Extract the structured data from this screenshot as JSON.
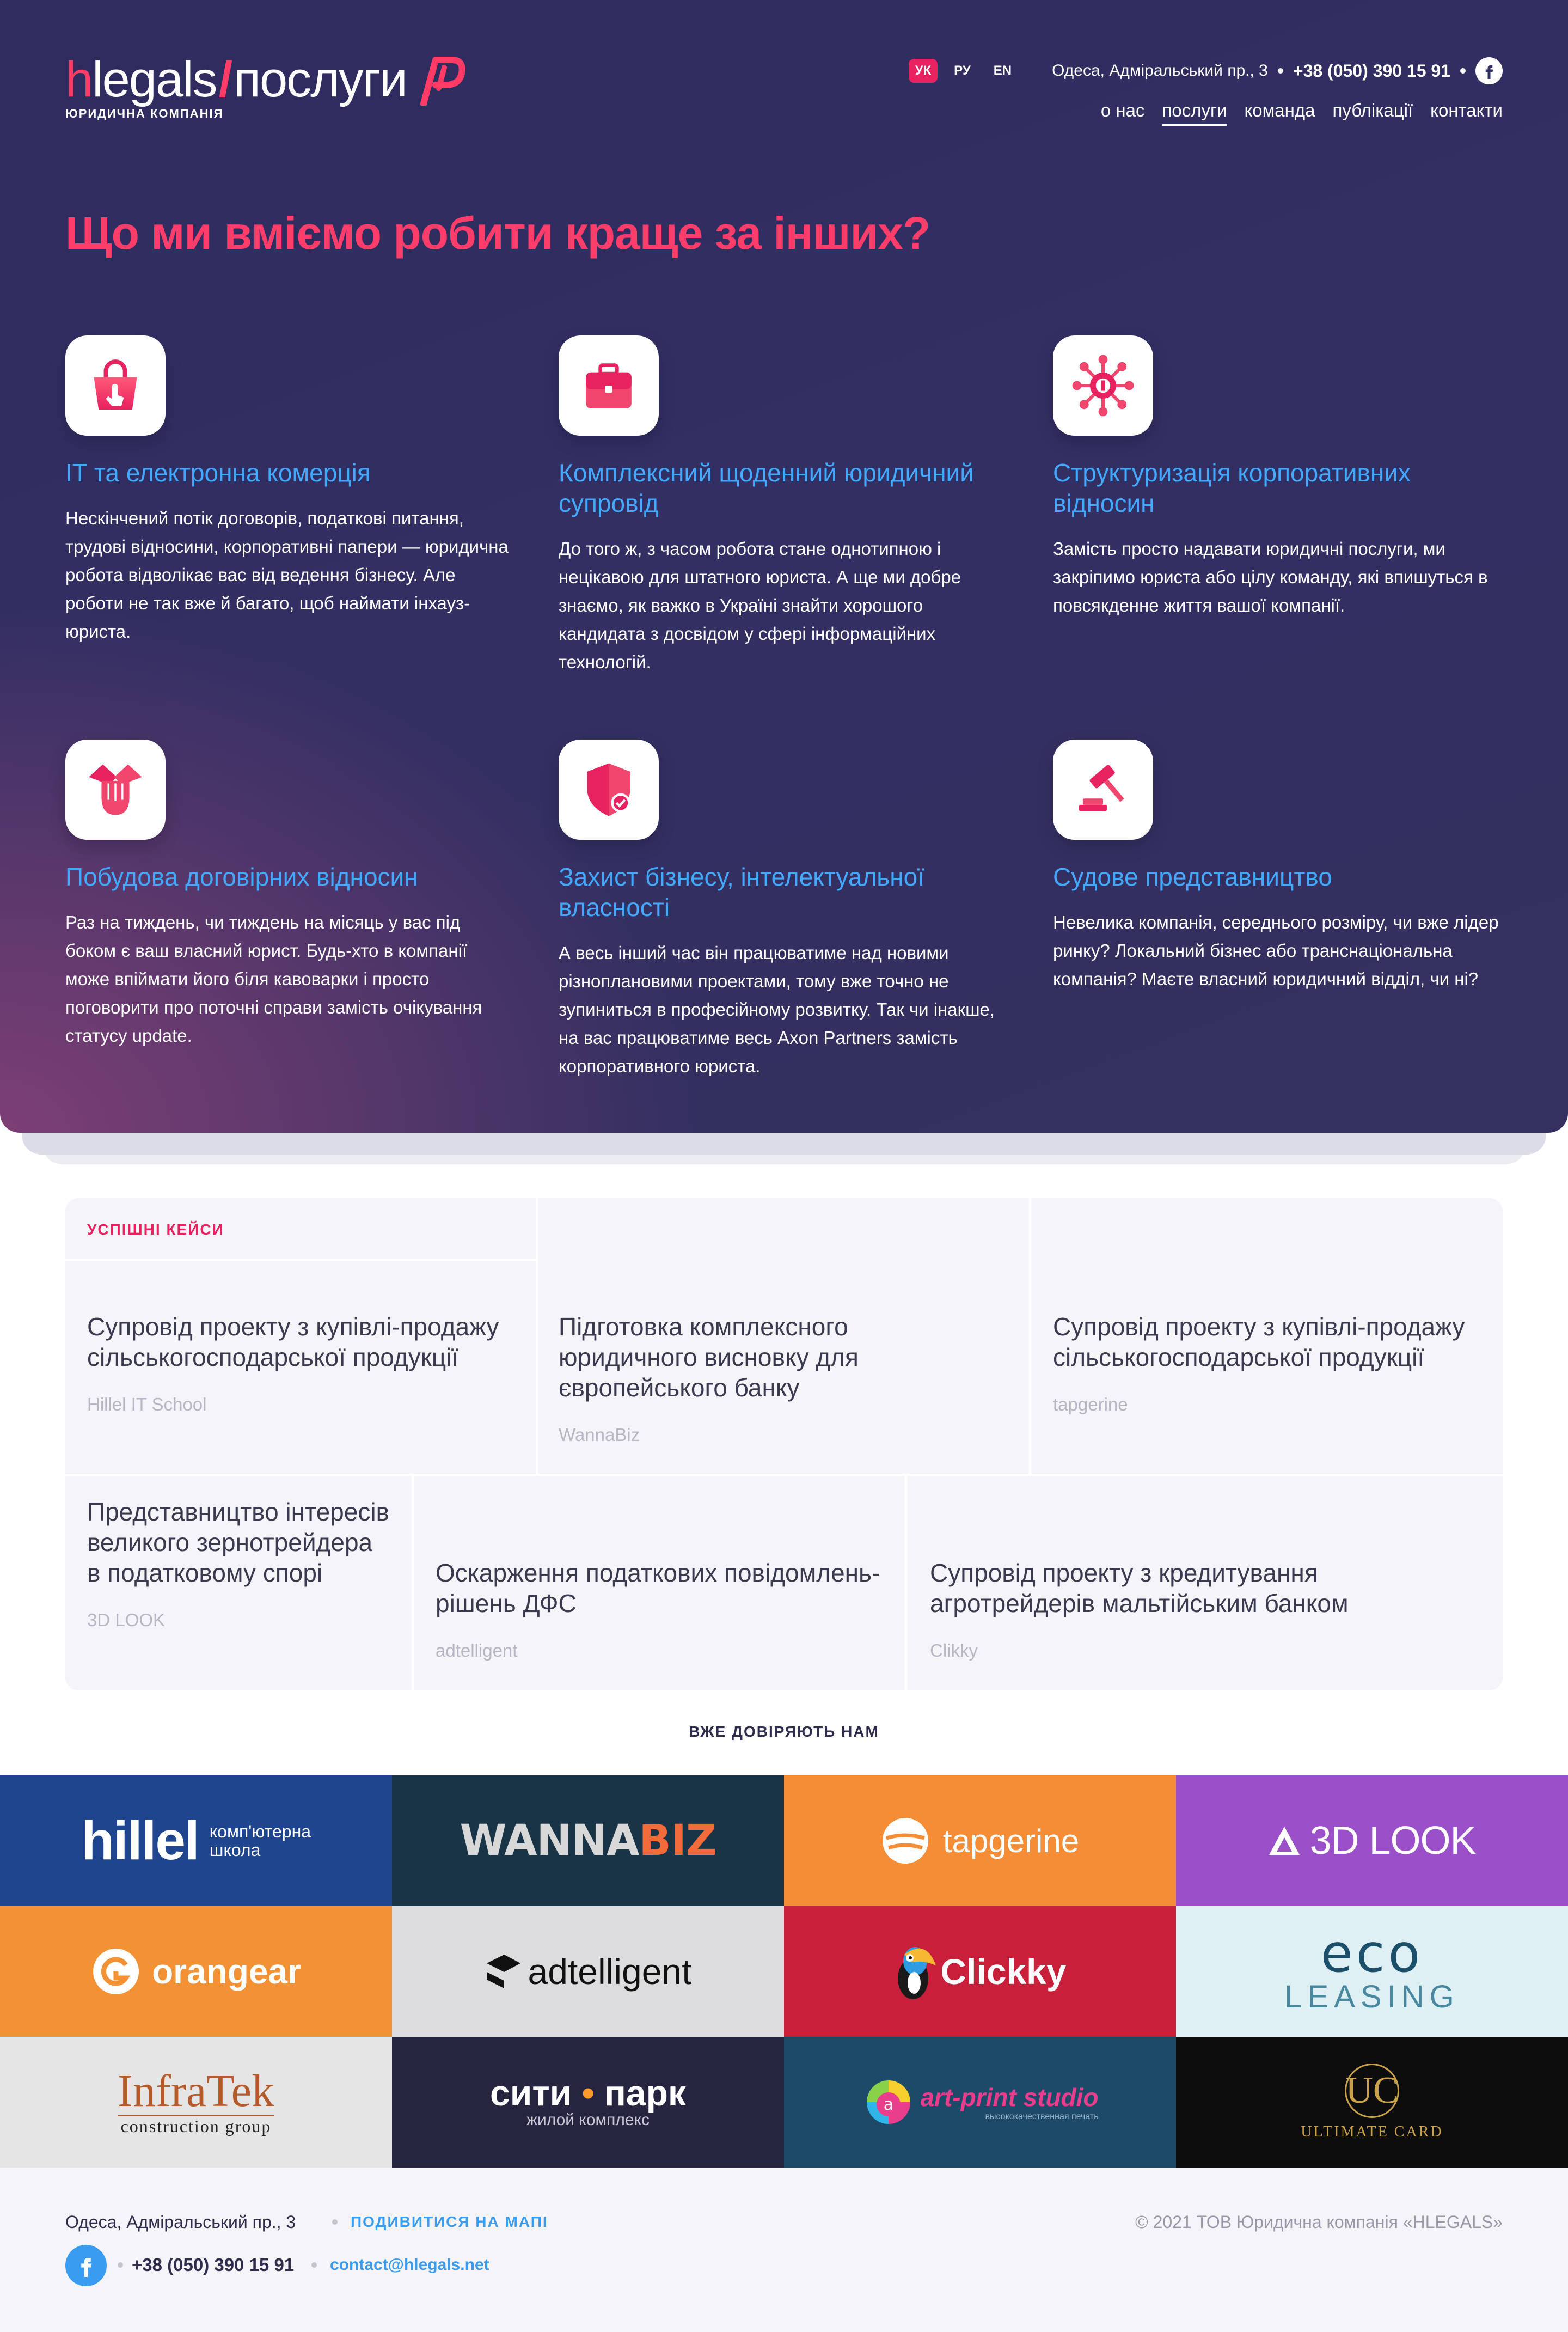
{
  "brand": {
    "name": "hlegals",
    "section": "послуги",
    "tagline": "ЮРИДИЧНА КОМПАНІЯ",
    "accent": "#ff3d6a",
    "link_color": "#44a8ff"
  },
  "header": {
    "languages": [
      "УК",
      "РУ",
      "EN"
    ],
    "active_language": "УК",
    "address": "Одеса, Адміральський пр., 3",
    "phone": "+38 (050) 390 15 91",
    "social_icon": "facebook-icon"
  },
  "nav": {
    "items": [
      {
        "label": "о нас",
        "active": false
      },
      {
        "label": "послуги",
        "active": true
      },
      {
        "label": "команда",
        "active": false
      },
      {
        "label": "публікації",
        "active": false
      },
      {
        "label": "контакти",
        "active": false
      }
    ]
  },
  "hero": {
    "title": "Що ми вміємо робити краще за інших?",
    "services": [
      {
        "icon": "shopping-bag-icon",
        "title": "IT та електронна комерція",
        "text": "Нескінчений потік договорів, податкові питання, трудові відносини, корпоративні папери — юридична робота відволікає вас від ведення бізнесу. Але роботи не так вже й багато, щоб наймати інхауз-юриста."
      },
      {
        "icon": "briefcase-icon",
        "title": "Комплексний щоденний юридичний супровід",
        "text": "До того ж, з часом робота стане однотипною і нецікавою для штатного юриста. А ще ми добре знаємо, як важко в Україні знайти хорошого кандидата з досвідом у сфері інформаційних технологій."
      },
      {
        "icon": "network-structure-icon",
        "title": "Структуризація корпоративних відносин",
        "text": "Замість просто надавати юридичні послуги, ми закріпимо юриста або цілу команду, які впишуться в повсякденне життя вашої компанії."
      },
      {
        "icon": "handshake-icon",
        "title": "Побудова договірних відносин",
        "text": "Раз на тиждень, чи тиждень на місяць у вас під боком є ваш власний юрист. Будь-хто в компанії може впіймати його біля кавоварки і просто поговорити про поточні справи замість очікування статусу update."
      },
      {
        "icon": "shield-check-icon",
        "title": "Захист бізнесу, інтелектуальної власності",
        "text": "А весь інший час він працюватиме над новими різноплановими проектами, тому вже точно не зупиниться в професійному розвитку. Так чи інакше, на вас працюватиме весь Axon Partners замість корпоративного юриста."
      },
      {
        "icon": "gavel-icon",
        "title": "Судове представництво",
        "text": "Невелика компанія, середнього розміру, чи вже лідер ринку? Локальний бізнес або транснаціональна компанія? Маєте власний юридичний відділ, чи ні?"
      }
    ]
  },
  "cases": {
    "label": "УСПІШНІ КЕЙСИ",
    "items": [
      {
        "title": "Супровід проекту з купівлі-продажу сільськогосподарської продукції",
        "client": "Hillel IT School"
      },
      {
        "title": "Підготовка комплексного юридичного висновку для європейського банку",
        "client": "WannaBiz"
      },
      {
        "title": "Супровід проекту з купівлі-продажу сільськогосподарської продукції",
        "client": "tapgerine"
      },
      {
        "title": "Представництво інтересів великого зернотрейдера в податковому спорі",
        "client": "3D LOOK"
      },
      {
        "title": "Оскарження податкових повідомлень-рішень ДФС",
        "client": "adtelligent"
      },
      {
        "title": "Супровід проекту з кредитування агротрейдерів мальтійським банком",
        "client": "Clikky"
      }
    ]
  },
  "trusted": {
    "label": "ВЖЕ ДОВІРЯЮТЬ НАМ",
    "logos": {
      "hillel": {
        "name": "hillel",
        "sub1": "комп'ютерна",
        "sub2": "школа",
        "bg": "#20458f"
      },
      "wannabiz": {
        "part1": "WANNA",
        "part2": "BIZ",
        "bg": "#1a3447"
      },
      "tapgerine": {
        "name": "tapgerine",
        "bg": "#f48d35"
      },
      "look3d": {
        "name": "3D LOOK",
        "bg": "#9a50c8"
      },
      "orangear": {
        "name": "orangear",
        "bg": "#f39234"
      },
      "adtelligent": {
        "name": "adtelligent",
        "bg": "#dcdcdf"
      },
      "clickky": {
        "name": "Clickky",
        "bg": "#c8203a"
      },
      "ecoleasing": {
        "name1": "eco",
        "name2": "LEASING",
        "bg": "#dff0f5"
      },
      "infratek": {
        "name": "InfraTek",
        "sub": "construction group",
        "bg": "#e5e5e5"
      },
      "citypark": {
        "name1": "сити",
        "name2": "парк",
        "sub": "жилой комплекс",
        "bg": "#252540"
      },
      "artprint": {
        "name": "art-print studio",
        "sub": "высококачественная печать",
        "bg": "#1e4a6a"
      },
      "ultimate": {
        "mark": "UC",
        "name": "ULTIMATE CARD",
        "bg": "#0d0d0d"
      }
    }
  },
  "footer": {
    "address": "Одеса, Адміральський пр., 3",
    "map_link": "ПОДИВИТИСЯ НА МАПІ",
    "phone": "+38 (050) 390 15 91",
    "email": "contact@hlegals.net",
    "copyright": "© 2021 ТОВ Юридична компанія «HLEGALS»"
  }
}
